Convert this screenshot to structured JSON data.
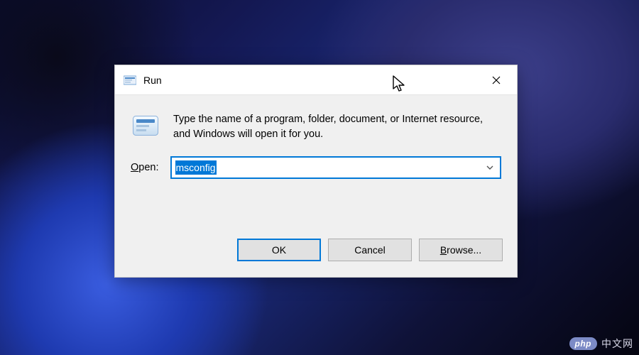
{
  "dialog": {
    "title": "Run",
    "description": "Type the name of a program, folder, document, or Internet resource, and Windows will open it for you.",
    "open_label_prefix": "O",
    "open_label_rest": "pen:",
    "input_value": "msconfig",
    "buttons": {
      "ok": "OK",
      "cancel": "Cancel",
      "browse_prefix": "B",
      "browse_rest": "rowse..."
    }
  },
  "watermark": {
    "badge": "php",
    "text": "中文网"
  }
}
